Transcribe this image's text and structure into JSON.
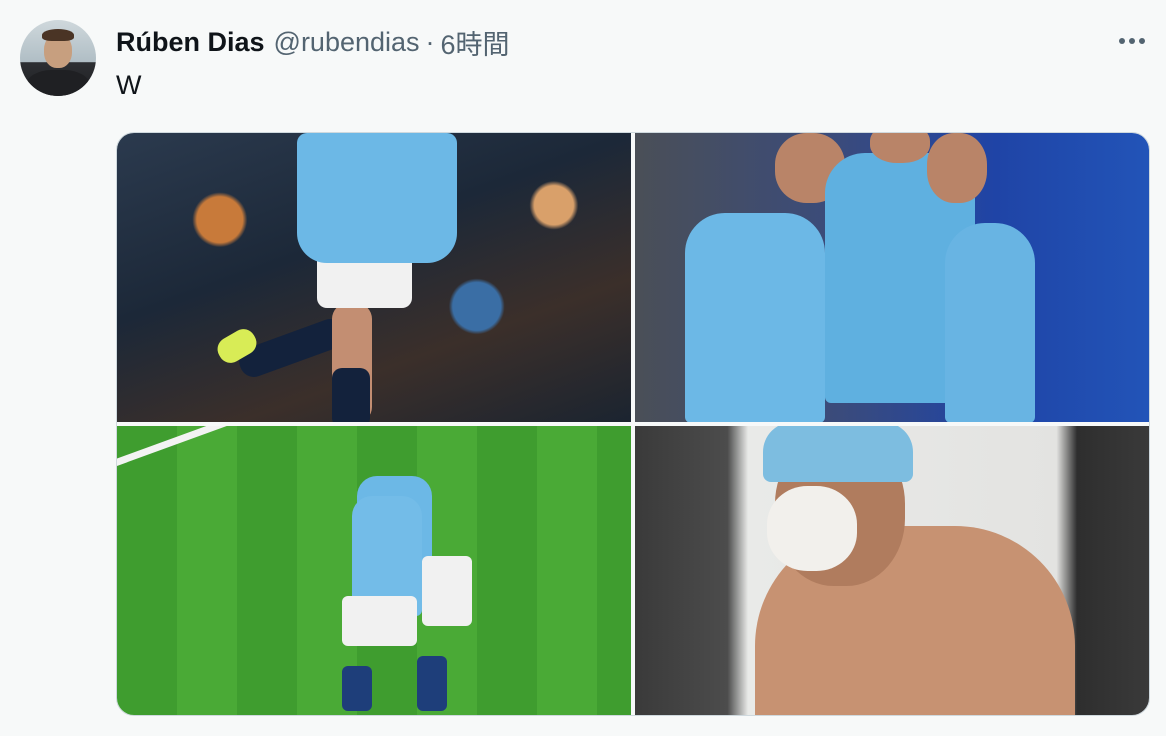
{
  "tweet": {
    "author_name": "Rúben Dias",
    "handle": "@rubendias",
    "separator": "·",
    "time": "6時間",
    "text": "W"
  },
  "media": {
    "count": 4
  },
  "icons": {
    "more": "more-horizontal-icon"
  }
}
